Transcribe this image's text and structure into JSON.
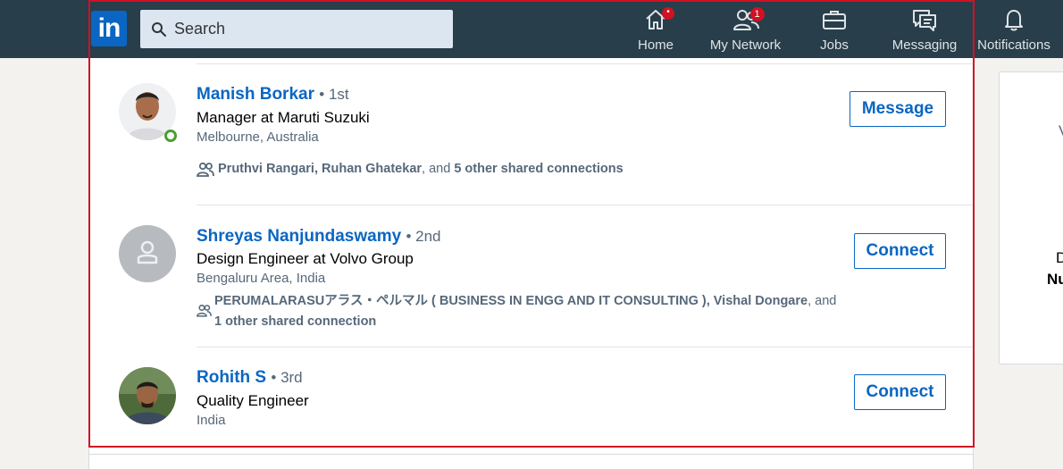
{
  "nav": {
    "logo": "in",
    "search_placeholder": "Search",
    "items": [
      {
        "label": "Home",
        "badge": "•"
      },
      {
        "label": "My Network",
        "badge": "1"
      },
      {
        "label": "Jobs",
        "badge": ""
      },
      {
        "label": "Messaging",
        "badge": ""
      },
      {
        "label": "Notifications",
        "badge": ""
      }
    ]
  },
  "people": [
    {
      "name": "Manish Borkar",
      "degree": "• 1st",
      "headline": "Manager at Maruti Suzuki",
      "location": "Melbourne, Australia",
      "shared_names": "Pruthvi Rangari, Ruhan Ghatekar",
      "shared_mid": ", and ",
      "shared_count": "5 other shared connections",
      "action": "Message",
      "online": true
    },
    {
      "name": "Shreyas Nanjundaswamy",
      "degree": "• 2nd",
      "headline": "Design Engineer at Volvo Group",
      "location": "Bengaluru Area, India",
      "shared_line1_names": "PERUMALARASUアラス・ペルマル ( BUSINESS IN ENGG AND IT CONSULTING ), Vishal Dongare",
      "shared_line1_tail": ", and",
      "shared_count": "1 other shared connection",
      "action": "Connect"
    },
    {
      "name": "Rohith S",
      "degree": "• 3rd",
      "headline": "Quality Engineer",
      "location": "India",
      "action": "Connect"
    }
  ],
  "side": {
    "t1": "V",
    "t2": "D",
    "t3": "Nu"
  },
  "colors": {
    "nav_bg": "#283e4a",
    "brand_blue": "#0a66c2",
    "badge_red": "#d11124",
    "online_green": "#4d9e2e",
    "highlight_red": "#d11124"
  }
}
